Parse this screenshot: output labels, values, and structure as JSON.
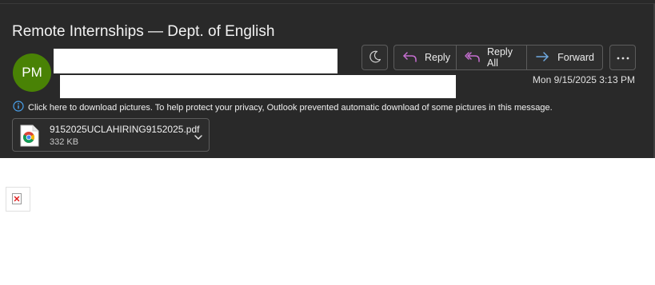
{
  "message": {
    "subject": "Remote Internships — Dept. of English",
    "sender_initials": "PM",
    "date": "Mon 9/15/2025 3:13 PM"
  },
  "actions": {
    "reply": "Reply",
    "reply_all": "Reply All",
    "forward": "Forward"
  },
  "info_bar": {
    "text": "Click here to download pictures. To help protect your privacy, Outlook prevented automatic download of some pictures in this message."
  },
  "attachment": {
    "name": "9152025UCLAHIRING9152025.pdf",
    "size": "332 KB",
    "icon": "chrome-pdf-icon"
  },
  "colors": {
    "header_bg": "#292929",
    "avatar_bg": "#498205",
    "reply_accent": "#c56fd0",
    "forward_accent": "#6fa9e0",
    "info_accent": "#4aa3f0"
  }
}
